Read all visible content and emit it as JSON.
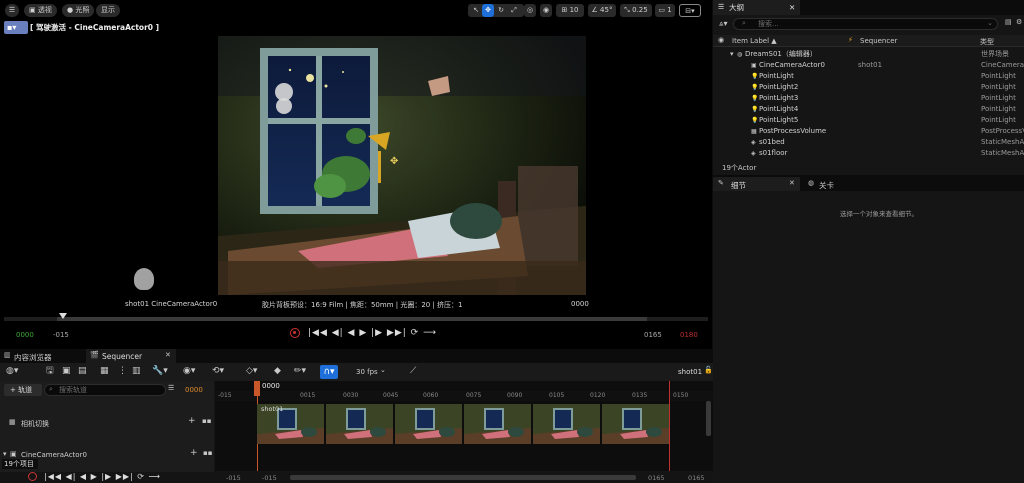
{
  "viewport": {
    "toolbar": {
      "perspective": "透视",
      "lit": "光照",
      "show": "显示",
      "grid_snap": "10",
      "rotation_snap": "45°",
      "scale_snap": "0.25",
      "camera_speed": "1"
    },
    "pilot_label": "[ 驾驶激活 - CineCameraActor0 ]",
    "info_left": "shot01  CineCameraActor0",
    "info_mid": "胶片背板预设：16:9 Film | 焦距：50mm | 光圈：20 | 挤压：1",
    "info_right": "0000",
    "tc": {
      "green": "0000",
      "start": "-015",
      "end": "0165",
      "red": "0180"
    }
  },
  "outliner": {
    "tab": "大纲",
    "search_placeholder": "搜索...",
    "header": {
      "label": "Item Label ▲",
      "sequencer": "Sequencer",
      "type": "类型"
    },
    "rows": [
      {
        "label": "DreamS01（编辑器）",
        "seq": "",
        "type": "世界场景",
        "icon": "world-icon"
      },
      {
        "label": "CineCameraActor0",
        "seq": "shot01",
        "type": "CineCameraA",
        "icon": "camera-icon"
      },
      {
        "label": "PointLight",
        "seq": "",
        "type": "PointLight",
        "icon": "bulb-icon"
      },
      {
        "label": "PointLight2",
        "seq": "",
        "type": "PointLight",
        "icon": "bulb-icon"
      },
      {
        "label": "PointLight3",
        "seq": "",
        "type": "PointLight",
        "icon": "bulb-icon"
      },
      {
        "label": "PointLight4",
        "seq": "",
        "type": "PointLight",
        "icon": "bulb-icon"
      },
      {
        "label": "PointLight5",
        "seq": "",
        "type": "PointLight",
        "icon": "bulb-icon"
      },
      {
        "label": "PostProcessVolume",
        "seq": "",
        "type": "PostProcessV",
        "icon": "volume-icon"
      },
      {
        "label": "s01bed",
        "seq": "",
        "type": "StaticMeshAc",
        "icon": "mesh-icon"
      },
      {
        "label": "s01floor",
        "seq": "",
        "type": "StaticMeshAc",
        "icon": "mesh-icon"
      }
    ],
    "count": "19个Actor"
  },
  "details": {
    "tab_details": "细节",
    "tab_level": "关卡",
    "empty": "选择一个对象来查看细节。"
  },
  "bottom": {
    "tab_content": "内容浏览器",
    "tab_sequencer": "Sequencer",
    "fps": "30 fps",
    "shot": "shot01",
    "add_track": "+ 轨道",
    "search_placeholder": "搜索轨道",
    "frame": "0000",
    "playhead": "0000",
    "ruler": [
      "-015",
      "0015",
      "0030",
      "0045",
      "0060",
      "0075",
      "0090",
      "0105",
      "0120",
      "0135",
      "0150"
    ],
    "track_camera_cut": "相机切换",
    "track_camera_actor": "CineCameraActor0",
    "items_count": "19个项目",
    "thumb_label": "shot01",
    "range_start": "-015",
    "range_start2": "-015",
    "range_end": "0165",
    "range_end2": "0165"
  },
  "colors": {
    "accent_blue": "#1e6fd9",
    "tc_green": "#3fa83f",
    "tc_red": "#c03030",
    "selected_orange": "#e08a2a"
  }
}
